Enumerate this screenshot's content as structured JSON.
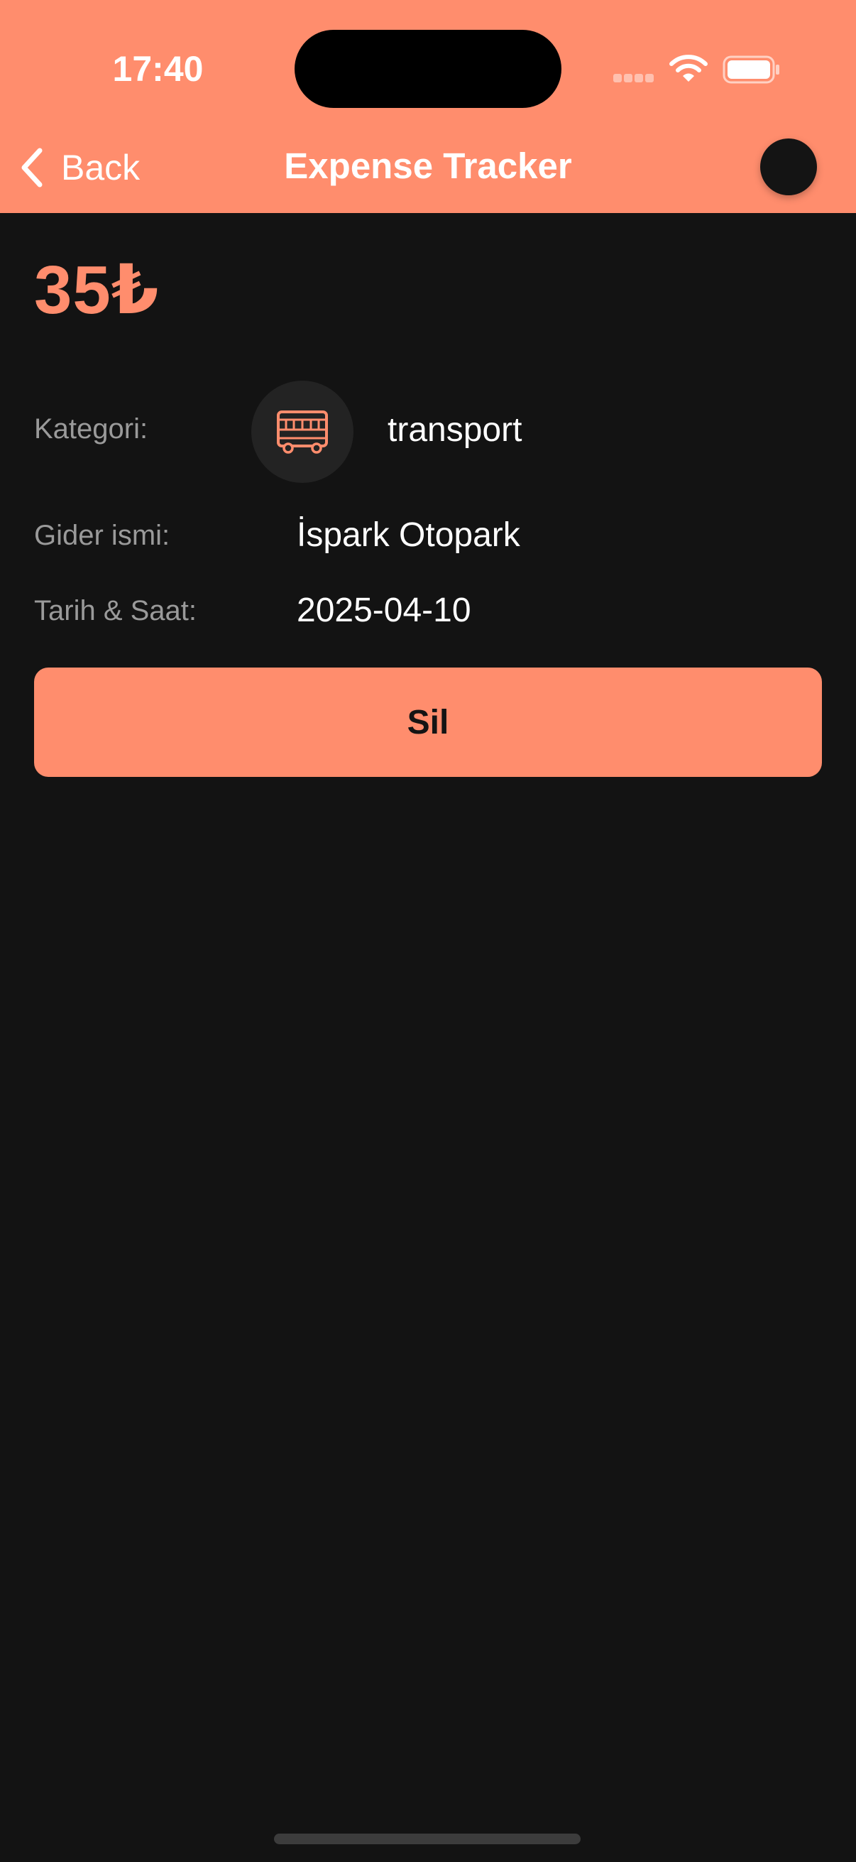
{
  "status_bar": {
    "time": "17:40",
    "signal_icon": "signal-dots-icon",
    "wifi_icon": "wifi-icon",
    "battery_icon": "battery-icon"
  },
  "nav": {
    "back_label": "Back",
    "back_icon": "chevron-left-icon",
    "title": "Expense Tracker",
    "avatar_icon": "avatar"
  },
  "expense": {
    "amount": "35₺",
    "category_label": "Kategori:",
    "category_icon": "bus-icon",
    "category_value": "transport",
    "name_label": "Gider ismi:",
    "name_value": "İspark Otopark",
    "date_label": "Tarih & Saat:",
    "date_value": "2025-04-10"
  },
  "actions": {
    "delete_label": "Sil"
  },
  "colors": {
    "accent": "#FF8D6D",
    "background": "#131313",
    "label": "#9A9A9A",
    "text": "#FFFFFF"
  }
}
